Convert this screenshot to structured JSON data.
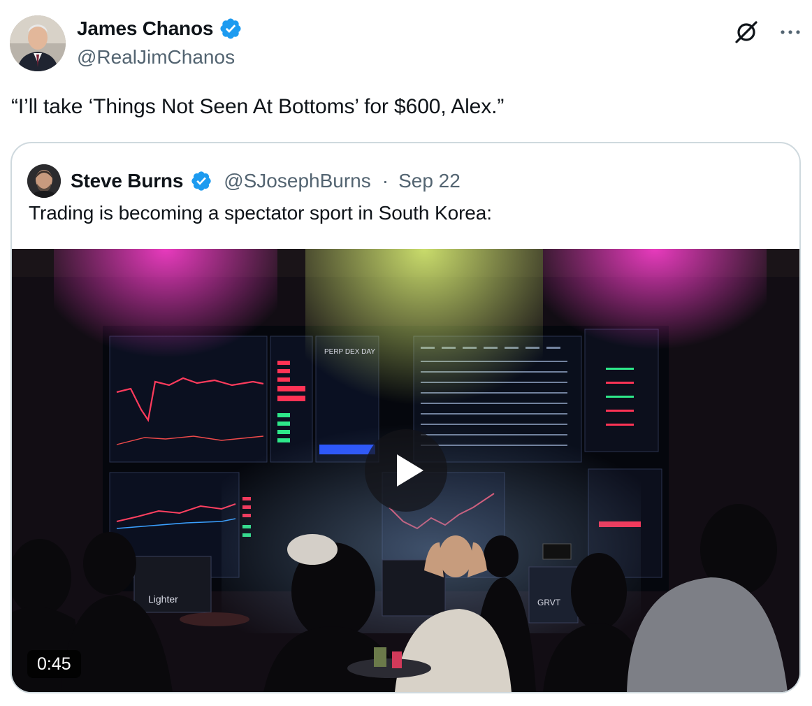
{
  "author": {
    "display_name": "James Chanos",
    "handle": "@RealJimChanos",
    "verified_icon": "verified-badge-icon"
  },
  "tweet": {
    "text": "“I’ll take ‘Things Not Seen At Bottoms’ for $600, Alex.”"
  },
  "quoted_tweet": {
    "display_name": "Steve Burns",
    "handle": "@SJosephBurns",
    "separator": "·",
    "date": "Sep 22",
    "text": "Trading is becoming a spectator sport in South Korea:",
    "media": {
      "type": "video",
      "duration": "0:45",
      "on_screen_text": [
        "Lighter",
        "GRVT",
        "PERP DEX DAY"
      ]
    }
  },
  "colors": {
    "verified_blue": "#1d9bf0",
    "secondary_text": "#536471",
    "border": "#cfd9de"
  }
}
